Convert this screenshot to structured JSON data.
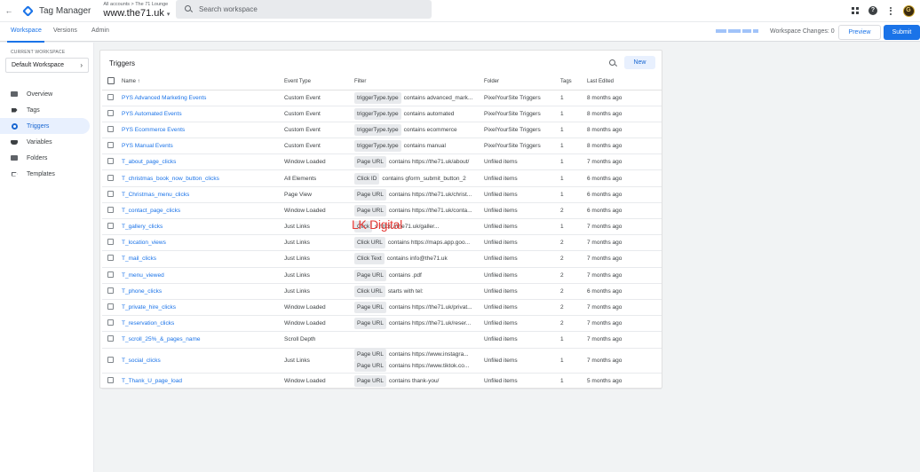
{
  "app": {
    "name": "Tag Manager",
    "breadcrumb": "All accounts > The 71 Lounge",
    "container": "www.the71.uk",
    "search_placeholder": "Search workspace",
    "avatar_letter": "G"
  },
  "tabs": [
    "Workspace",
    "Versions",
    "Admin"
  ],
  "toolbar": {
    "workspace_changes": "Workspace Changes: 0",
    "preview": "Preview",
    "submit": "Submit"
  },
  "sidebar": {
    "current_workspace_label": "CURRENT WORKSPACE",
    "workspace_name": "Default Workspace",
    "items": [
      {
        "label": "Overview",
        "icon": "folder-icon"
      },
      {
        "label": "Tags",
        "icon": "tag-icon"
      },
      {
        "label": "Triggers",
        "icon": "trigger-icon"
      },
      {
        "label": "Variables",
        "icon": "variables-icon"
      },
      {
        "label": "Folders",
        "icon": "folder-icon"
      },
      {
        "label": "Templates",
        "icon": "template-icon"
      }
    ]
  },
  "triggers": {
    "title": "Triggers",
    "new_button": "New",
    "columns": [
      "Name ↑",
      "Event Type",
      "Filter",
      "Folder",
      "Tags",
      "Last Edited"
    ],
    "rows": [
      {
        "name": "PYS Advanced Marketing Events",
        "event": "Custom Event",
        "filters": [
          {
            "var": "triggerType.type",
            "cond": "contains advanced_mark..."
          }
        ],
        "folder": "PixelYourSite Triggers",
        "tags": "1",
        "edited": "8 months ago"
      },
      {
        "name": "PYS Automated Events",
        "event": "Custom Event",
        "filters": [
          {
            "var": "triggerType.type",
            "cond": "contains automated"
          }
        ],
        "folder": "PixelYourSite Triggers",
        "tags": "1",
        "edited": "8 months ago"
      },
      {
        "name": "PYS Ecommerce Events",
        "event": "Custom Event",
        "filters": [
          {
            "var": "triggerType.type",
            "cond": "contains ecommerce"
          }
        ],
        "folder": "PixelYourSite Triggers",
        "tags": "1",
        "edited": "8 months ago"
      },
      {
        "name": "PYS Manual Events",
        "event": "Custom Event",
        "filters": [
          {
            "var": "triggerType.type",
            "cond": "contains manual"
          }
        ],
        "folder": "PixelYourSite Triggers",
        "tags": "1",
        "edited": "8 months ago"
      },
      {
        "name": "T_about_page_clicks",
        "event": "Window Loaded",
        "filters": [
          {
            "var": "Page URL",
            "cond": "contains https://the71.uk/about/"
          }
        ],
        "folder": "Unfiled items",
        "tags": "1",
        "edited": "7 months ago"
      },
      {
        "name": "T_christmas_book_now_button_clicks",
        "event": "All Elements",
        "filters": [
          {
            "var": "Click ID",
            "cond": "contains gform_submit_button_2"
          }
        ],
        "folder": "Unfiled items",
        "tags": "1",
        "edited": "6 months ago"
      },
      {
        "name": "T_Christmas_menu_clicks",
        "event": "Page View",
        "filters": [
          {
            "var": "Page URL",
            "cond": "contains https://the71.uk/christ..."
          }
        ],
        "folder": "Unfiled items",
        "tags": "1",
        "edited": "6 months ago"
      },
      {
        "name": "T_contact_page_clicks",
        "event": "Window Loaded",
        "filters": [
          {
            "var": "Page URL",
            "cond": "contains https://the71.uk/conta..."
          }
        ],
        "folder": "Unfiled items",
        "tags": "2",
        "edited": "6 months ago"
      },
      {
        "name": "T_gallery_clicks",
        "event": "Just Links",
        "filters": [
          {
            "var": "Click",
            "cond": "s https://the71.uk/galler..."
          }
        ],
        "folder": "Unfiled items",
        "tags": "1",
        "edited": "7 months ago"
      },
      {
        "name": "T_location_views",
        "event": "Just Links",
        "filters": [
          {
            "var": "Click URL",
            "cond": "contains https://maps.app.goo..."
          }
        ],
        "folder": "Unfiled items",
        "tags": "2",
        "edited": "7 months ago"
      },
      {
        "name": "T_mail_clicks",
        "event": "Just Links",
        "filters": [
          {
            "var": "Click Text",
            "cond": "contains info@the71.uk"
          }
        ],
        "folder": "Unfiled items",
        "tags": "2",
        "edited": "7 months ago"
      },
      {
        "name": "T_menu_viewed",
        "event": "Just Links",
        "filters": [
          {
            "var": "Page URL",
            "cond": "contains .pdf"
          }
        ],
        "folder": "Unfiled items",
        "tags": "2",
        "edited": "7 months ago"
      },
      {
        "name": "T_phone_clicks",
        "event": "Just Links",
        "filters": [
          {
            "var": "Click URL",
            "cond": "starts with tel:"
          }
        ],
        "folder": "Unfiled items",
        "tags": "2",
        "edited": "6 months ago"
      },
      {
        "name": "T_private_hire_clicks",
        "event": "Window Loaded",
        "filters": [
          {
            "var": "Page URL",
            "cond": "contains https://the71.uk/privat..."
          }
        ],
        "folder": "Unfiled items",
        "tags": "2",
        "edited": "7 months ago"
      },
      {
        "name": "T_reservation_clicks",
        "event": "Window Loaded",
        "filters": [
          {
            "var": "Page URL",
            "cond": "contains https://the71.uk/reser..."
          }
        ],
        "folder": "Unfiled items",
        "tags": "2",
        "edited": "7 months ago"
      },
      {
        "name": "T_scroll_25%_&_pages_name",
        "event": "Scroll Depth",
        "filters": [],
        "folder": "Unfiled items",
        "tags": "1",
        "edited": "7 months ago"
      },
      {
        "name": "T_social_clicks",
        "event": "Just Links",
        "filters": [
          {
            "var": "Page URL",
            "cond": "contains https://www.instagra..."
          },
          {
            "var": "Page URL",
            "cond": "contains https://www.tiktok.co..."
          }
        ],
        "folder": "Unfiled items",
        "tags": "1",
        "edited": "7 months ago"
      },
      {
        "name": "T_Thank_U_page_load",
        "event": "Window Loaded",
        "filters": [
          {
            "var": "Page URL",
            "cond": "contains thank-you/"
          }
        ],
        "folder": "Unfiled items",
        "tags": "1",
        "edited": "5 months ago"
      }
    ]
  },
  "watermark": "LK Digital",
  "colors": {
    "accent": "#1a73e8",
    "active_nav_bg": "#e8f0fe",
    "watermark": "#e53935"
  }
}
